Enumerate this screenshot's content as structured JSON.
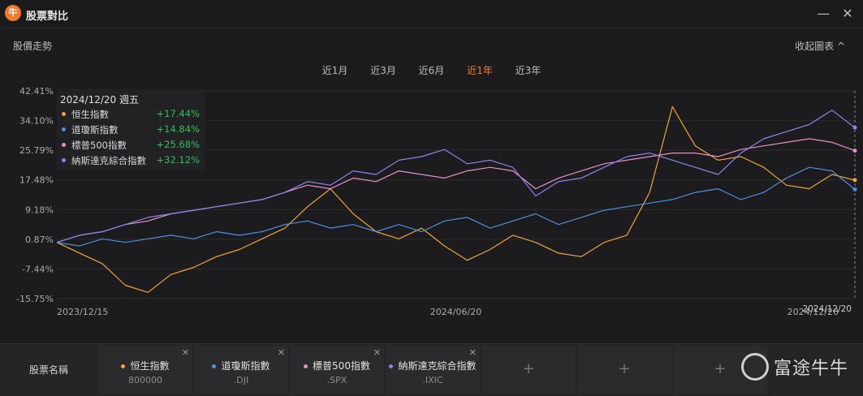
{
  "window": {
    "title": "股票對比",
    "logo_text": "牛",
    "minimize": "—",
    "close": "✕"
  },
  "header": {
    "section_title": "股價走勢",
    "collapse_label": "收起圖表 ^"
  },
  "periods": [
    {
      "label": "近1月",
      "active": false
    },
    {
      "label": "近3月",
      "active": false
    },
    {
      "label": "近6月",
      "active": false
    },
    {
      "label": "近1年",
      "active": true
    },
    {
      "label": "近3年",
      "active": false
    }
  ],
  "tooltip": {
    "date": "2024/12/20 週五",
    "rows": [
      {
        "name": "恒生指數",
        "value": "+17.44%",
        "color": "#f0a53a"
      },
      {
        "name": "道瓊斯指數",
        "value": "+14.84%",
        "color": "#4d8fe0"
      },
      {
        "name": "標普500指數",
        "value": "+25.68%",
        "color": "#e68fc7"
      },
      {
        "name": "納斯達克綜合指數",
        "value": "+32.12%",
        "color": "#8c82f0"
      }
    ]
  },
  "chart_data": {
    "type": "line",
    "x_ticks": [
      "2023/12/15",
      "2024/06/20",
      "2024/12/20"
    ],
    "y_ticks": [
      "42.41%",
      "34.10%",
      "25.79%",
      "17.48%",
      "9.18%",
      "0.87%",
      "-7.44%",
      "-15.75%"
    ],
    "ylim": [
      -15.75,
      42.41
    ],
    "crosshair_label": "2024/12/20",
    "series": [
      {
        "name": "恒生指數",
        "color": "#f0a53a",
        "values": [
          0,
          -3,
          -6,
          -12,
          -14,
          -9,
          -7,
          -4,
          -2,
          1,
          4,
          10,
          15,
          8,
          3,
          1,
          4,
          -1,
          -5,
          -2,
          2,
          0,
          -3,
          -4,
          0,
          2,
          14,
          38,
          27,
          23,
          24,
          21,
          16,
          15,
          19,
          17.44
        ]
      },
      {
        "name": "道瓊斯指數",
        "color": "#4d8fe0",
        "values": [
          0,
          -1,
          1,
          0,
          1,
          2,
          1,
          3,
          2,
          3,
          5,
          6,
          4,
          5,
          3,
          5,
          3,
          6,
          7,
          4,
          6,
          8,
          5,
          7,
          9,
          10,
          11,
          12,
          14,
          15,
          12,
          14,
          18,
          21,
          20,
          14.84
        ]
      },
      {
        "name": "標普500指數",
        "color": "#e68fc7",
        "values": [
          0,
          2,
          3,
          5,
          6,
          8,
          9,
          10,
          11,
          12,
          14,
          16,
          15,
          18,
          17,
          20,
          19,
          18,
          20,
          21,
          20,
          15,
          18,
          20,
          22,
          23,
          24,
          25,
          25,
          24,
          26,
          27,
          28,
          29,
          28,
          25.68
        ]
      },
      {
        "name": "納斯達克綜合指數",
        "color": "#8c82f0",
        "values": [
          0,
          2,
          3,
          5,
          7,
          8,
          9,
          10,
          11,
          12,
          14,
          17,
          16,
          20,
          19,
          23,
          24,
          26,
          22,
          23,
          21,
          13,
          17,
          18,
          21,
          24,
          25,
          23,
          21,
          19,
          25,
          29,
          31,
          33,
          37,
          32.12
        ]
      }
    ]
  },
  "bottom": {
    "label": "股票名稱",
    "slots": [
      {
        "name": "恒生指數",
        "code": "800000",
        "color": "#f0a53a"
      },
      {
        "name": "道瓊斯指數",
        "code": ".DJI",
        "color": "#4d8fe0"
      },
      {
        "name": "標普500指數",
        "code": ".SPX",
        "color": "#e68fc7"
      },
      {
        "name": "納斯達克綜合指數",
        "code": ".IXIC",
        "color": "#8c82f0"
      }
    ],
    "empty_plus": "+",
    "close_glyph": "✕"
  },
  "watermark": {
    "text": "富途牛牛"
  }
}
